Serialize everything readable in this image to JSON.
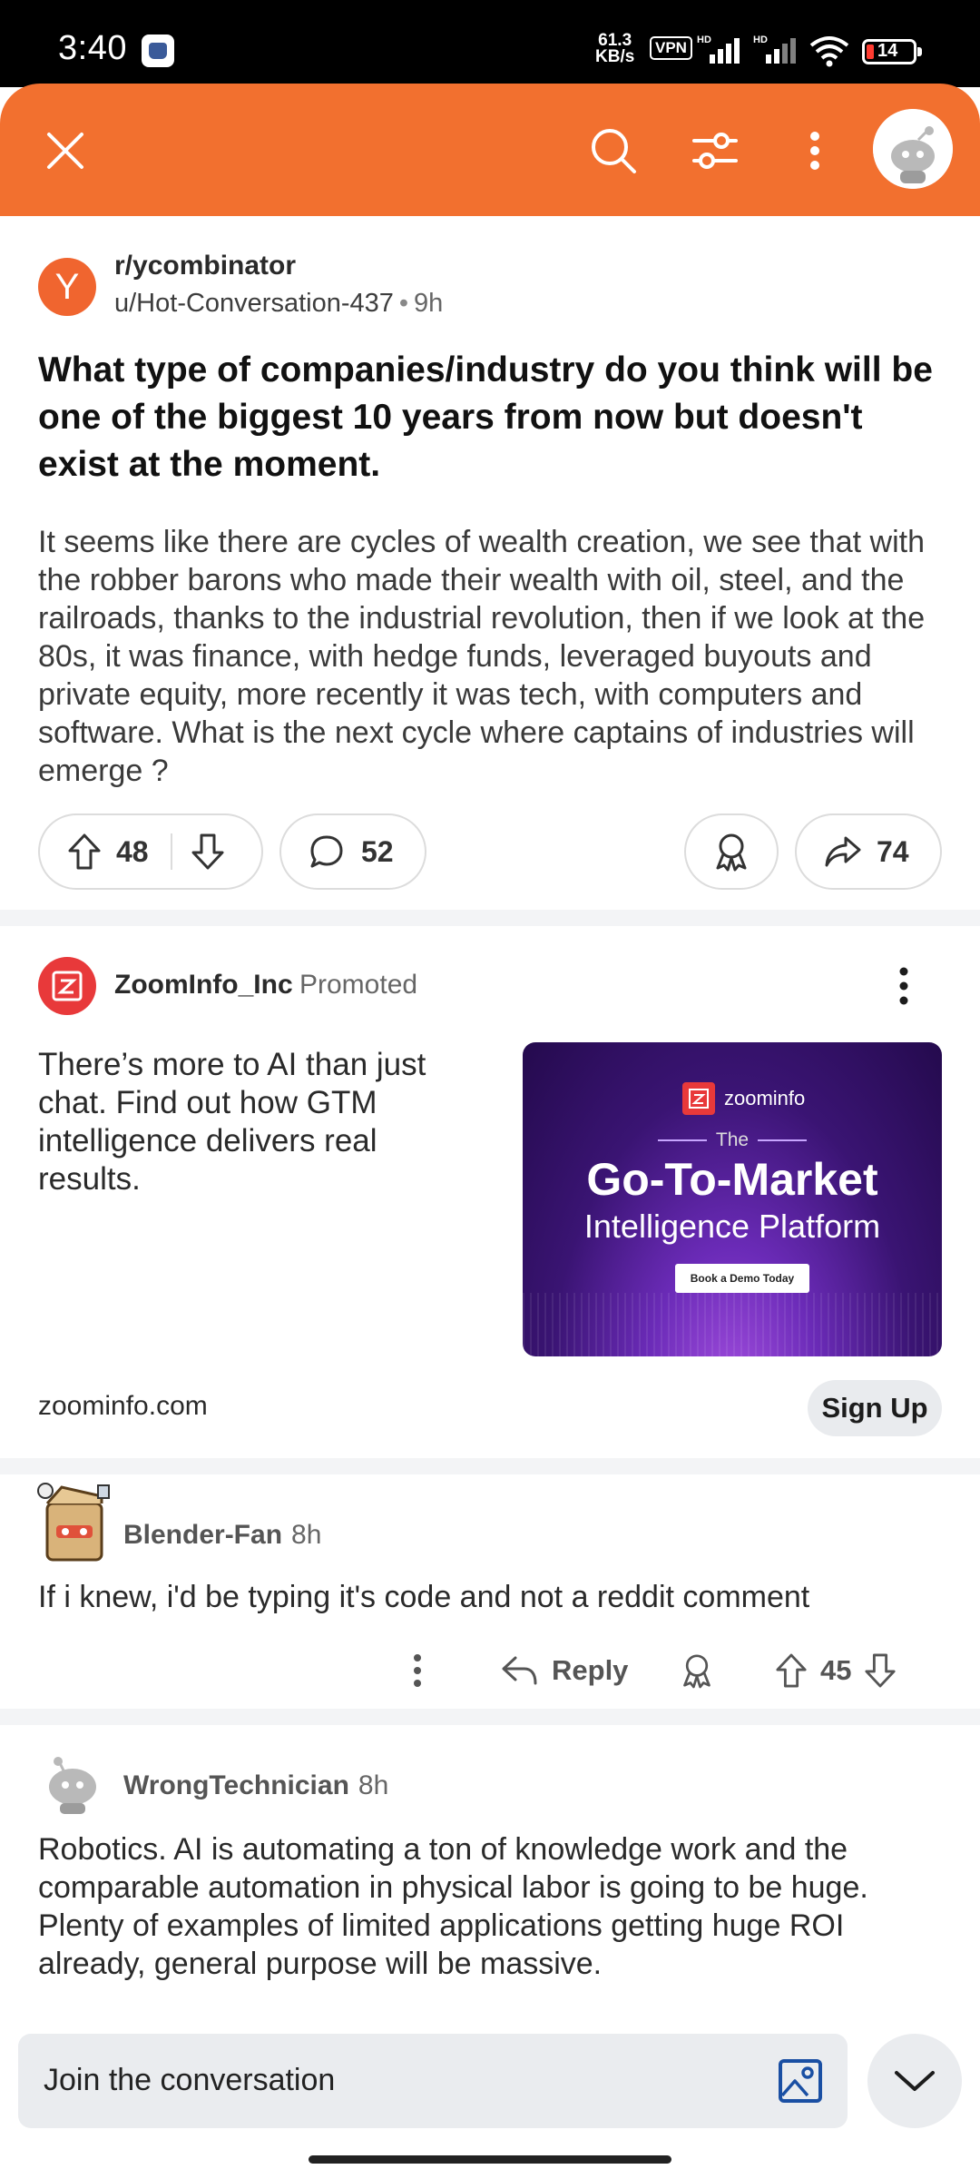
{
  "status_bar": {
    "time": "3:40",
    "net_speed_value": "61.3",
    "net_speed_unit": "KB/s",
    "vpn": "VPN",
    "hd1": "HD",
    "hd2": "HD",
    "battery": "14"
  },
  "header": {
    "icons": [
      "close-icon",
      "search-icon",
      "filter-icon",
      "more-vertical-icon",
      "avatar"
    ]
  },
  "post": {
    "subreddit": "r/ycombinator",
    "author": "u/Hot-Conversation-437",
    "separator": "•",
    "age": "9h",
    "subreddit_initial": "Y",
    "title": "What type of companies/industry do you think will be one of the biggest 10 years from now but doesn't exist at the moment.",
    "body": "It seems like there are cycles of wealth creation, we see that with the robber barons who made their wealth with oil, steel, and the railroads, thanks to the industrial revolution, then if we look at the 80s, it was finance, with hedge funds, leveraged buyouts and private equity, more recently it was tech, with computers and software. What is the next cycle where captains of industries will emerge ?",
    "upvotes": "48",
    "comments": "52",
    "shares": "74"
  },
  "ad": {
    "advertiser": "ZoomInfo_Inc",
    "promoted": "Promoted",
    "text": "There’s more to AI than just chat. Find out how GTM intelligence delivers real results.",
    "image": {
      "logo_text": "zoominfo",
      "the": "The",
      "headline": "Go-To-Market",
      "subheadline": "Intelligence Platform",
      "cta": "Book a Demo Today"
    },
    "domain": "zoominfo.com",
    "cta_button": "Sign Up"
  },
  "comments": [
    {
      "author": "Blender-Fan",
      "age": "8h",
      "text": "If i knew, i'd be typing it's code and not a reddit comment",
      "reply_label": "Reply",
      "score": "45"
    },
    {
      "author": "WrongTechnician",
      "age": "8h",
      "text": "Robotics. AI is automating a ton of knowledge work and the comparable automation in physical labor is going to be huge. Plenty of examples of limited applications getting huge ROI already, general purpose will be massive."
    }
  ],
  "composer": {
    "placeholder": "Join the conversation"
  },
  "colors": {
    "brand_orange": "#f2702f",
    "ad_red": "#e8393a"
  }
}
